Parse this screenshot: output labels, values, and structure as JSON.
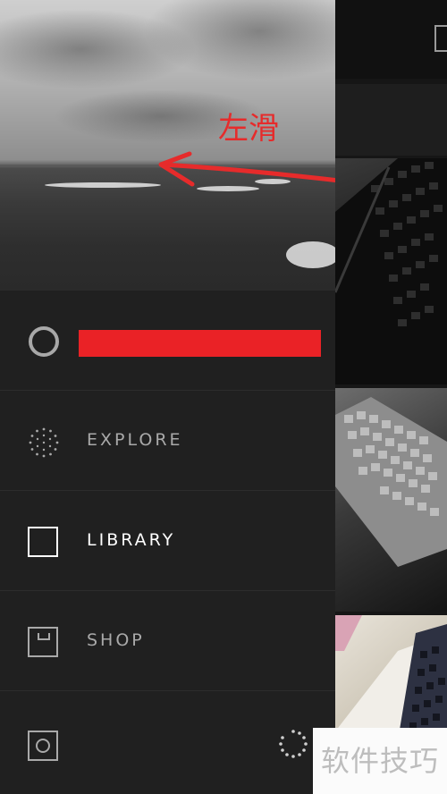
{
  "annotation": {
    "swipe_text": "左滑",
    "color": "#e62b2b"
  },
  "profile": {
    "username": "",
    "username_redaction_color": "#ea2226"
  },
  "menu": [
    {
      "label": "EXPLORE",
      "icon": "dotted-circle-icon",
      "active": false
    },
    {
      "label": "LIBRARY",
      "icon": "square-icon",
      "active": true
    },
    {
      "label": "SHOP",
      "icon": "shop-box-icon",
      "active": false
    }
  ],
  "footer": {
    "settings_icon": "settings-square-icon",
    "loading_icon": "loading-spinner-icon"
  },
  "watermark": {
    "text": "软件技巧"
  },
  "colors": {
    "drawer_bg": "#202020",
    "text_active": "#ffffff",
    "text_inactive": "#a9a9a9"
  }
}
